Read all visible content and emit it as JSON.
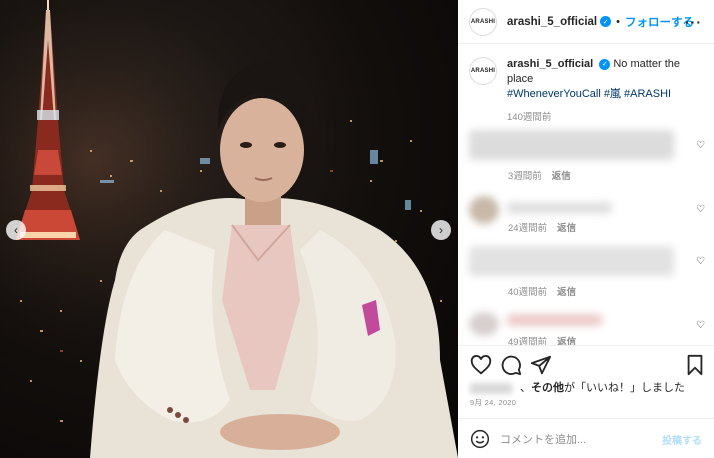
{
  "post": {
    "account": {
      "avatar_text": "ARASHI",
      "username": "arashi_5_official",
      "verified": true
    },
    "follow_label": "フォローする",
    "more_icon": "more-horizontal-icon",
    "caption": {
      "username": "arashi_5_official",
      "text": "No matter the place",
      "hashtags": "#WheneverYouCall #嵐 #ARASHI",
      "time": "140週間前"
    },
    "comments": [
      {
        "time": "3週間前",
        "reply_label": "返信"
      },
      {
        "time": "24週間前",
        "reply_label": "返信"
      },
      {
        "time": "40週間前",
        "reply_label": "返信"
      },
      {
        "time": "49週間前",
        "reply_label": "返信"
      }
    ],
    "likes_text_prefix": "、",
    "likes_text_bold": "その他",
    "likes_text_suffix": "が「いいね！」しました",
    "date": "9月 24, 2020",
    "add_comment_placeholder": "コメントを追加...",
    "post_label": "投稿する",
    "carousel": {
      "prev_icon": "chevron-left-icon",
      "next_icon": "chevron-right-icon"
    }
  },
  "colors": {
    "accent": "#0095f6",
    "tag": "#00376b",
    "muted": "#8e8e8e"
  }
}
